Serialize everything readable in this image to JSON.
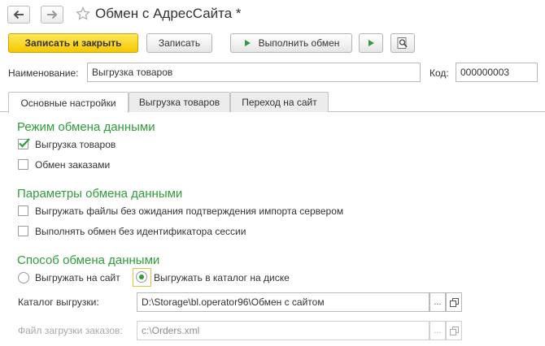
{
  "window": {
    "title": "Обмен с АдресСайта *",
    "back_icon": "arrow-left-icon",
    "forward_icon": "arrow-right-icon",
    "favorite_icon": "star-icon"
  },
  "toolbar": {
    "save_close_label": "Записать и закрыть",
    "save_label": "Записать",
    "run_exchange_label": "Выполнить обмен",
    "run_icon": "play-icon",
    "search_icon": "search-report-icon"
  },
  "header_fields": {
    "name_label": "Наименование:",
    "name_value": "Выгрузка товаров",
    "code_label": "Код:",
    "code_value": "000000003"
  },
  "tabs": [
    {
      "label": "Основные настройки",
      "active": true
    },
    {
      "label": "Выгрузка товаров",
      "active": false
    },
    {
      "label": "Переход на сайт",
      "active": false
    }
  ],
  "mode_section": {
    "title": "Режим обмена данными",
    "options": [
      {
        "label": "Выгрузка товаров",
        "checked": true
      },
      {
        "label": "Обмен заказами",
        "checked": false
      }
    ]
  },
  "params_section": {
    "title": "Параметры обмена данными",
    "options": [
      {
        "label": "Выгружать файлы без ожидания подтверждения импорта сервером",
        "checked": false
      },
      {
        "label": "Выполнять обмен без идентификатора сессии",
        "checked": false
      }
    ]
  },
  "method_section": {
    "title": "Способ обмена данными",
    "radio_site": "Выгружать на сайт",
    "radio_disk": "Выгружать в каталог на диске",
    "selected": "disk"
  },
  "paths": {
    "export_dir_label": "Каталог выгрузки:",
    "export_dir_value": "D:\\Storage\\bl.operator96\\Обмен с сайтом",
    "orders_file_label": "Файл загрузки заказов:",
    "orders_file_value": "c:\\Orders.xml",
    "select_button": "...",
    "open_icon": "open-window-icon"
  },
  "colors": {
    "accent_green": "#2f9e3a",
    "primary_yellow": "#f5c800"
  }
}
